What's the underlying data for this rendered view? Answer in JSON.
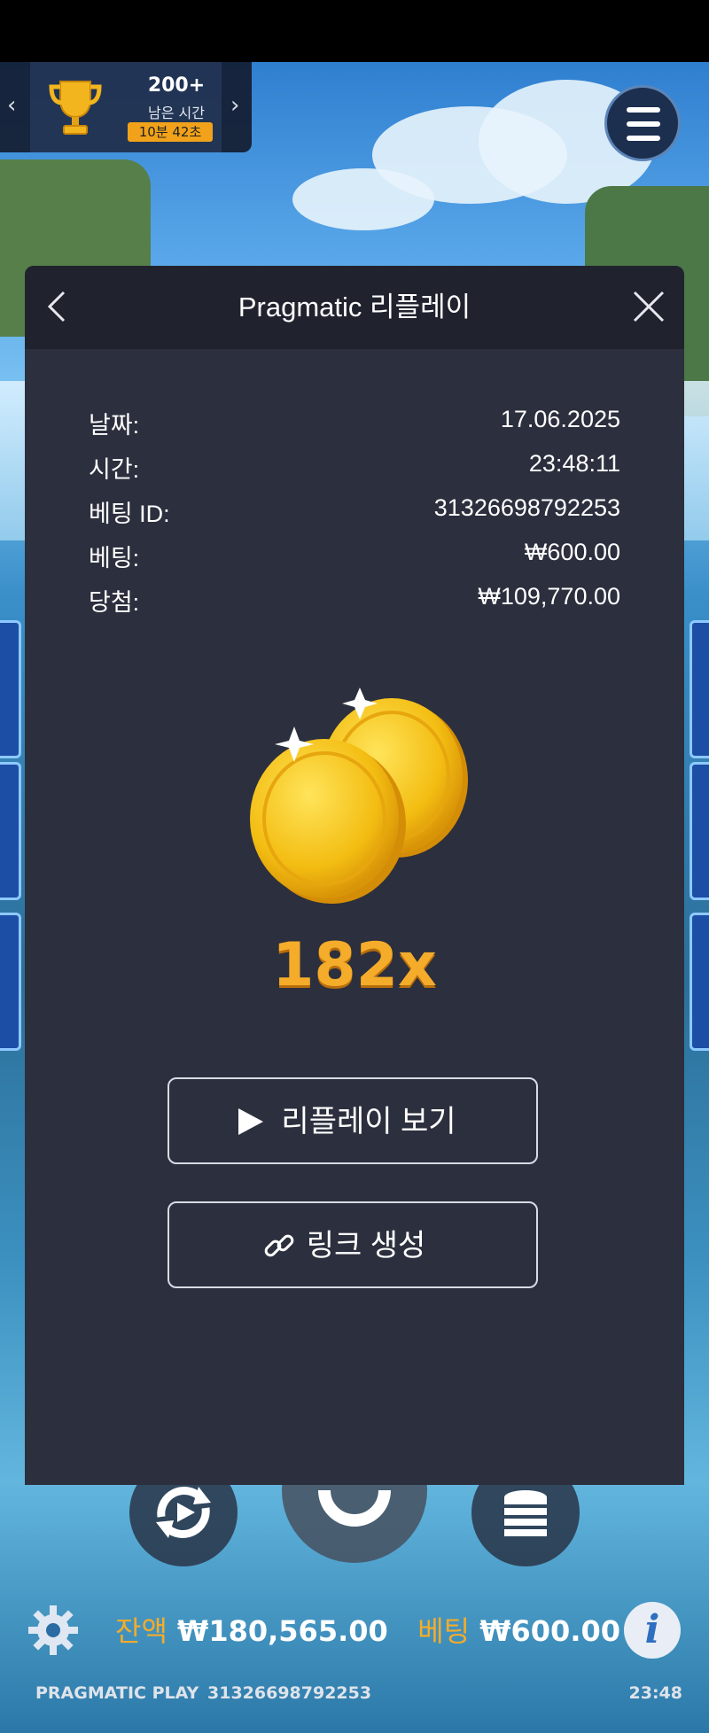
{
  "leaderboard": {
    "score": "200+",
    "label": "남은 시간",
    "timer": "10분 42초"
  },
  "dialog": {
    "title": "Pragmatic 리플레이",
    "rows": [
      {
        "key": "날짜:",
        "value": "17.06.2025"
      },
      {
        "key": "시간:",
        "value": "23:48:11"
      },
      {
        "key": "베팅 ID:",
        "value": "31326698792253"
      },
      {
        "key": "베팅:",
        "value": "₩600.00"
      },
      {
        "key": "당첨:",
        "value": "₩109,770.00"
      }
    ],
    "multiplier": "182x",
    "replay_button": "리플레이 보기",
    "link_button": "링크 생성"
  },
  "bottom": {
    "balance_label": "잔액",
    "balance_value": "₩180,565.00",
    "bet_label": "베팅",
    "bet_value": "₩600.00"
  },
  "footer": {
    "brand": "PRAGMATIC PLAY",
    "bet_id": "31326698792253",
    "clock": "23:48"
  },
  "colors": {
    "accent": "#f4ac2a",
    "dialog_bg": "#2c2f3d",
    "dialog_header": "#20232e"
  },
  "icons": [
    "trophy-icon",
    "chevron-left-icon",
    "chevron-right-icon",
    "menu-icon",
    "back-icon",
    "close-icon",
    "coins-icon",
    "play-icon",
    "link-icon",
    "autoplay-icon",
    "spin-icon",
    "coin-stack-icon",
    "gear-icon",
    "info-icon"
  ]
}
